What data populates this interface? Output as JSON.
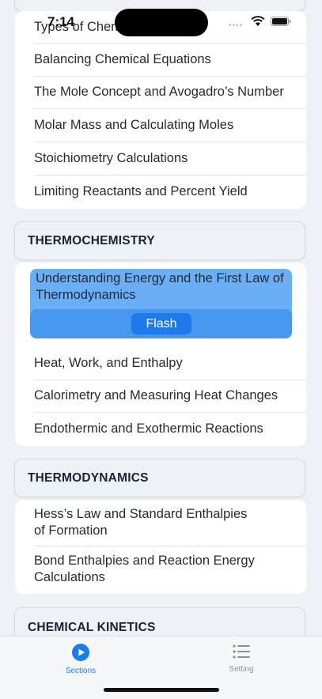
{
  "status_bar": {
    "time": "7:14"
  },
  "section_1_rows": [
    "Types of Chemical Reactions",
    "Balancing Chemical Equations",
    "The Mole Concept and Avogadro’s Number",
    "Molar Mass and Calculating Moles",
    "Stoichiometry Calculations",
    "Limiting Reactants and Percent Yield"
  ],
  "thermochemistry": {
    "title": "THERMOCHEMISTRY",
    "selected": {
      "line1": "Understanding Energy and the First Law of",
      "line2": "Thermodynamics",
      "flash_label": "Flash"
    },
    "rows": [
      "Heat, Work, and Enthalpy",
      "Calorimetry and Measuring Heat Changes",
      "Endothermic and Exothermic Reactions"
    ]
  },
  "thermodynamics": {
    "title": "THERMODYNAMICS",
    "rows": [
      {
        "line1": "Hess’s Law and Standard Enthalpies",
        "line2": "of Formation"
      },
      {
        "line1": "Bond Enthalpies and Reaction Energy",
        "line2": "Calculations"
      }
    ]
  },
  "chemical_kinetics": {
    "title": "CHEMICAL KINETICS"
  },
  "tabbar": {
    "sections_label": "Sections",
    "setting_label": "Setting",
    "active_color": "#1a7cf0",
    "inactive_color": "#8a8f98"
  }
}
